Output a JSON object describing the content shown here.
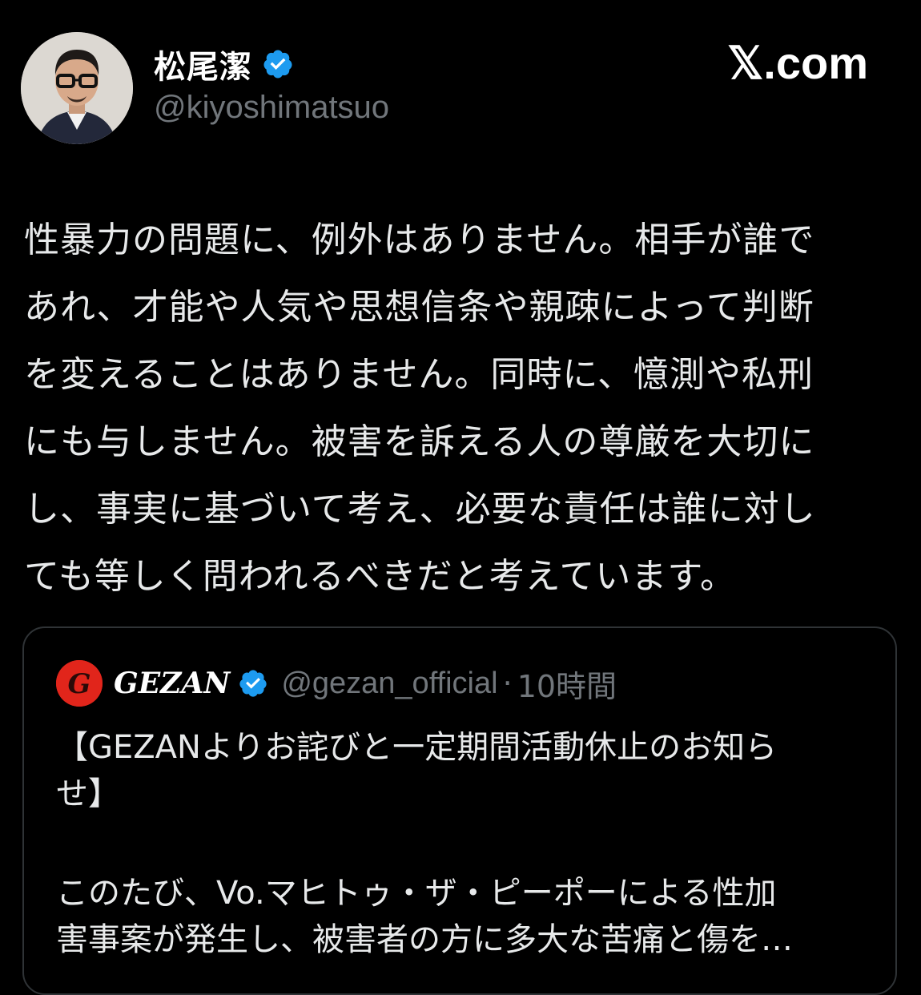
{
  "author": {
    "display_name": "松尾潔",
    "handle": "@kiyoshimatsuo",
    "verified_icon": "verified-badge-icon",
    "avatar_icon": "profile-photo"
  },
  "site_label": "𝕏.com",
  "tweet": {
    "text": "性暴力の問題に、例外はありません。相手が誰で\nあれ、才能や人気や思想信条や親疎によって判断\nを変えることはありません。同時に、憶測や私刑\nにも与しません。被害を訴える人の尊厳を大切に\nし、事実に基づいて考え、必要な責任は誰に対し\nても等しく問われるべきだと考えています。"
  },
  "quoted_tweet": {
    "display_name": "GEZAN",
    "handle": "@gezan_official",
    "separator": "·",
    "time": "10時間",
    "title": "【GEZANよりお詫びと一定期間活動休止のお知ら\nせ】",
    "body": "このたび、Vo.マヒトゥ・ザ・ピーポーによる性加\n害事案が発生し、被害者の方に多大な苦痛と傷を…"
  },
  "colors": {
    "background": "#000000",
    "text": "#e7e9ea",
    "muted": "#71767b",
    "verified": "#1d9bf0",
    "border": "#2f3336",
    "gezan_red": "#e1251b"
  }
}
